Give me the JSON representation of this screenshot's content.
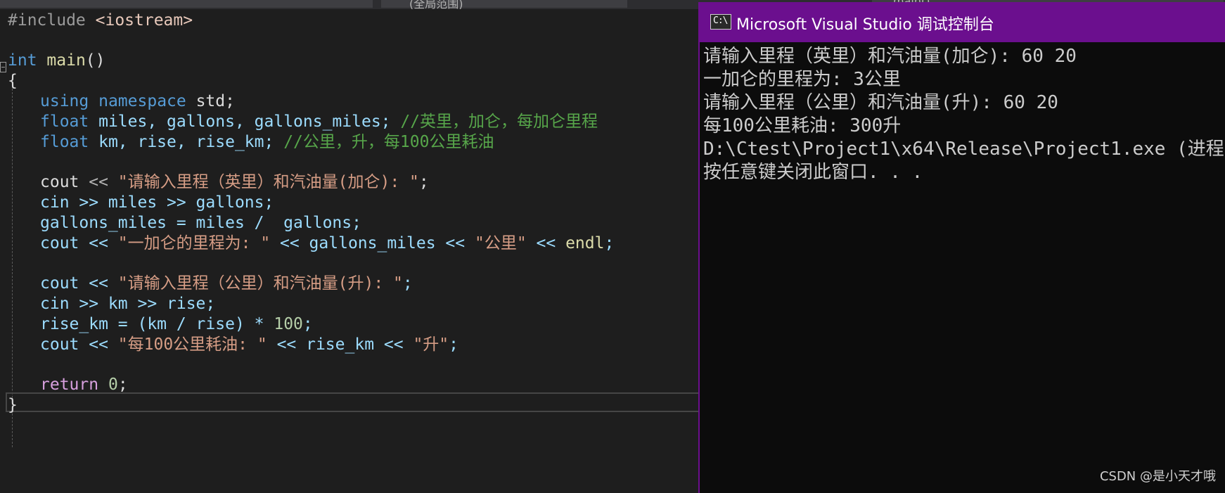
{
  "topbar": {
    "tab_fragment_center": "(全局范围)",
    "tab_fragment_right": "main()"
  },
  "editor": {
    "lines": {
      "l1": {
        "pp": "#include ",
        "inc": "<iostream>"
      },
      "l3": {
        "kw": "int",
        "fn": "main",
        "rest": "()"
      },
      "l4": {
        "text": "{"
      },
      "l5": {
        "kw1": "using",
        "kw2": "namespace",
        "rest": " std;"
      },
      "l6": {
        "kw": "float",
        "rest": " miles, gallons, gallons_miles; ",
        "cmt": "//英里，加仑，每加仑里程"
      },
      "l7": {
        "kw": "float",
        "rest": " km, rise, rise_km; ",
        "cmt": "//公里，升，每100公里耗油"
      },
      "l9": {
        "a": "cout ",
        "op": "<< ",
        "str": "\"请输入里程（英里）和汽油量(加仑): \"",
        "end": ";"
      },
      "l10": {
        "text": "cin >> miles >> gallons;"
      },
      "l11": {
        "text": "gallons_miles = miles /  gallons;"
      },
      "l12": {
        "a": "cout << ",
        "str1": "\"一加仑的里程为: \"",
        "b": " << gallons_miles << ",
        "str2": "\"公里\"",
        "c": " << ",
        "fn": "endl",
        "end": ";"
      },
      "l14": {
        "a": "cout << ",
        "str": "\"请输入里程（公里）和汽油量(升): \"",
        "end": ";"
      },
      "l15": {
        "text": "cin >> km >> rise;"
      },
      "l16": {
        "a": "rise_km = (km / rise) * ",
        "num": "100",
        "end": ";"
      },
      "l17": {
        "a": "cout << ",
        "str1": "\"每100公里耗油: \"",
        "b": " << rise_km << ",
        "str2": "\"升\"",
        "end": ";"
      },
      "l19": {
        "kw": "return",
        "sp": " ",
        "num": "0",
        "end": ";"
      },
      "l20": {
        "text": "}"
      }
    }
  },
  "console": {
    "title": "Microsoft Visual Studio 调试控制台",
    "icon_label": "C:\\",
    "lines": [
      "请输入里程（英里）和汽油量(加仑): 60 20",
      "一加仑的里程为: 3公里",
      "请输入里程（公里）和汽油量(升): 60 20",
      "每100公里耗油: 300升",
      "D:\\Ctest\\Project1\\x64\\Release\\Project1.exe (进程",
      "按任意键关闭此窗口. . ."
    ]
  },
  "watermark": "CSDN @是小天才哦",
  "colors": {
    "console_title_bg": "#6b0f8e",
    "editor_bg": "#1e1e1e",
    "console_bg": "#0c0c0c"
  }
}
